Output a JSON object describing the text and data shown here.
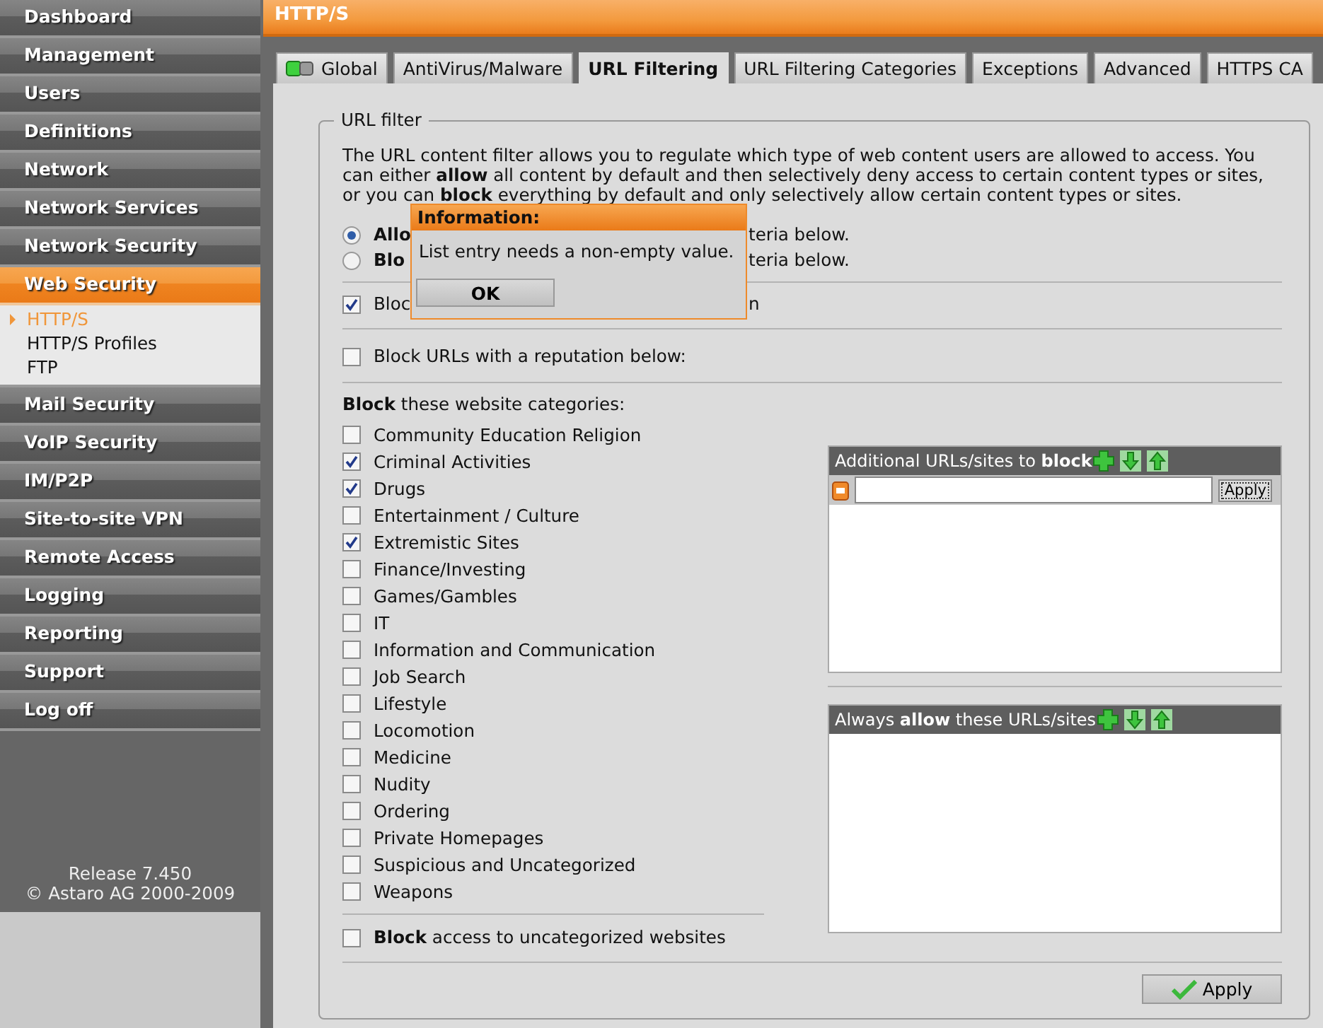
{
  "sidebar": {
    "items": [
      {
        "label": "Dashboard",
        "selected": false
      },
      {
        "label": "Management",
        "selected": false
      },
      {
        "label": "Users",
        "selected": false
      },
      {
        "label": "Definitions",
        "selected": false
      },
      {
        "label": "Network",
        "selected": false
      },
      {
        "label": "Network Services",
        "selected": false
      },
      {
        "label": "Network Security",
        "selected": false
      },
      {
        "label": "Web Security",
        "selected": true,
        "children": [
          {
            "label": "HTTP/S",
            "selected": true
          },
          {
            "label": "HTTP/S Profiles",
            "selected": false
          },
          {
            "label": "FTP",
            "selected": false
          }
        ]
      },
      {
        "label": "Mail Security",
        "selected": false
      },
      {
        "label": "VoIP Security",
        "selected": false
      },
      {
        "label": "IM/P2P",
        "selected": false
      },
      {
        "label": "Site-to-site VPN",
        "selected": false
      },
      {
        "label": "Remote Access",
        "selected": false
      },
      {
        "label": "Logging",
        "selected": false
      },
      {
        "label": "Reporting",
        "selected": false
      },
      {
        "label": "Support",
        "selected": false
      },
      {
        "label": "Log off",
        "selected": false
      }
    ],
    "release": "Release 7.450",
    "copyright": "© Astaro AG 2000-2009"
  },
  "page_title": "HTTP/S",
  "tabs": [
    {
      "label": "Global",
      "selected": false,
      "kind": "status"
    },
    {
      "label": "AntiVirus/Malware",
      "selected": false,
      "kind": "plain"
    },
    {
      "label": "URL Filtering",
      "selected": true,
      "kind": "plain"
    },
    {
      "label": "URL Filtering Categories",
      "selected": false,
      "kind": "plain"
    },
    {
      "label": "Exceptions",
      "selected": false,
      "kind": "plain"
    },
    {
      "label": "Advanced",
      "selected": false,
      "kind": "plain"
    },
    {
      "label": "HTTPS CA",
      "selected": false,
      "kind": "plain"
    }
  ],
  "fieldset": {
    "legend": "URL filter",
    "description": "The URL content filter allows you to regulate which type of web content users are allowed to access. You can either **allow** all content by default and then selectively deny access to certain content types or sites, or you can **block** everything by default and only selectively allow certain content types or sites.",
    "mode_options": [
      {
        "visible_start": "**Allo**",
        "visible_end": "teria below.",
        "selected": true
      },
      {
        "visible_start": "**Blo**",
        "visible_end": "teria below.",
        "selected": false
      }
    ],
    "spyware_option": {
      "visible_start": "Bloc",
      "visible_end": "n",
      "checked": true
    },
    "reputation_option": {
      "label": "Block URLs with a reputation below:",
      "checked": false
    },
    "categories_heading": "**Block** these website categories:",
    "categories": [
      {
        "label": "Community Education Religion",
        "checked": false
      },
      {
        "label": "Criminal Activities",
        "checked": true
      },
      {
        "label": "Drugs",
        "checked": true
      },
      {
        "label": "Entertainment / Culture",
        "checked": false
      },
      {
        "label": "Extremistic Sites",
        "checked": true
      },
      {
        "label": "Finance/Investing",
        "checked": false
      },
      {
        "label": "Games/Gambles",
        "checked": false
      },
      {
        "label": "IT",
        "checked": false
      },
      {
        "label": "Information and Communication",
        "checked": false
      },
      {
        "label": "Job Search",
        "checked": false
      },
      {
        "label": "Lifestyle",
        "checked": false
      },
      {
        "label": "Locomotion",
        "checked": false
      },
      {
        "label": "Medicine",
        "checked": false
      },
      {
        "label": "Nudity",
        "checked": false
      },
      {
        "label": "Ordering",
        "checked": false
      },
      {
        "label": "Private Homepages",
        "checked": false
      },
      {
        "label": "Suspicious and Uncategorized",
        "checked": false
      },
      {
        "label": "Weapons",
        "checked": false
      }
    ],
    "uncategorized_option": {
      "label": "**Block** access to uncategorized websites",
      "checked": false
    },
    "block_list": {
      "title": "Additional URLs/sites to **block**",
      "apply_label": "Apply"
    },
    "allow_list": {
      "title": "Always **allow** these URLs/sites"
    },
    "apply_button": "Apply"
  },
  "dialog": {
    "title": "Information:",
    "message": "List entry needs a non-empty value.",
    "ok_label": "OK"
  }
}
